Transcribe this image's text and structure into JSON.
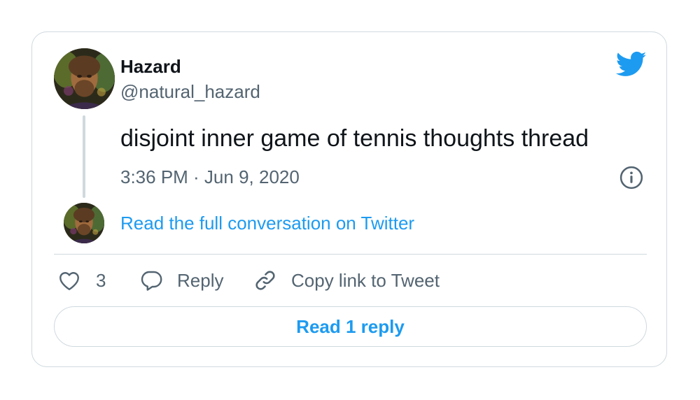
{
  "author": {
    "name": "Hazard",
    "handle": "@natural_hazard"
  },
  "tweet": {
    "text": "disjoint inner game of tennis thoughts thread",
    "timestamp": "3:36 PM · Jun 9, 2020"
  },
  "thread": {
    "read_full_conversation": "Read the full conversation on Twitter"
  },
  "actions": {
    "like_count": "3",
    "reply_label": "Reply",
    "copy_link_label": "Copy link to Tweet"
  },
  "read_reply_button": "Read 1 reply",
  "icons": {
    "brand": "twitter-bird-icon",
    "info": "info-icon",
    "like": "heart-icon",
    "reply": "speech-bubble-icon",
    "copy": "link-icon"
  },
  "colors": {
    "accent": "#1d9bf0",
    "text_primary": "#0f1419",
    "text_secondary": "#536471",
    "border": "#cfd9de"
  }
}
